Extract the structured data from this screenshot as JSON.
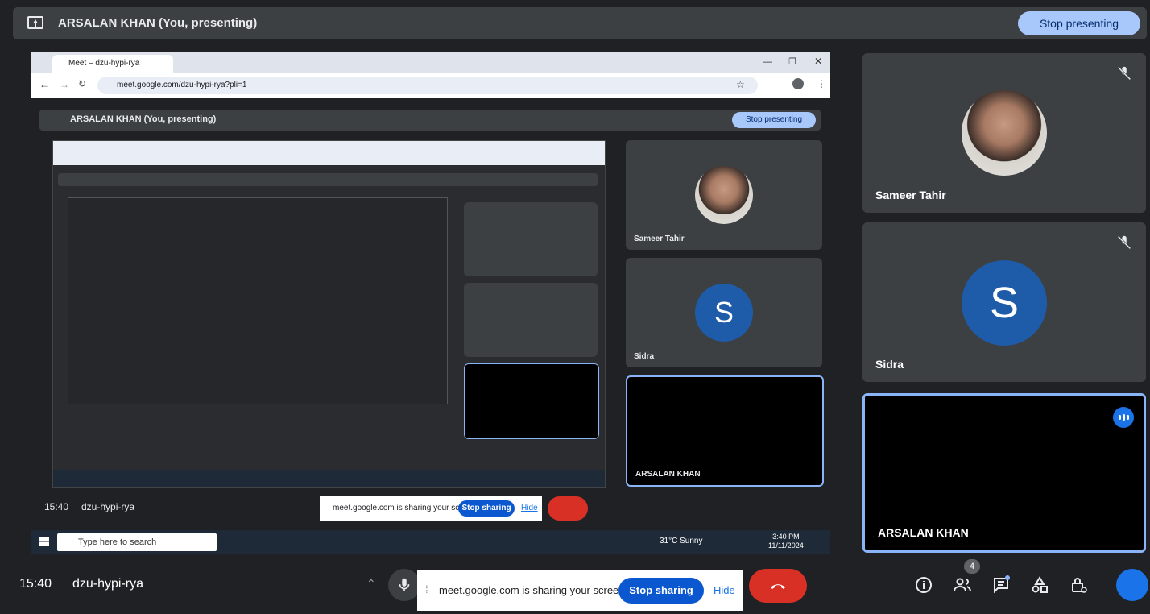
{
  "top_bar": {
    "title": "ARSALAN KHAN (You, presenting)",
    "stop_presenting": "Stop presenting"
  },
  "shared_screen": {
    "browser_tab": "Meet – dzu-hypi-rya",
    "url": "meet.google.com/dzu-hypi-rya?pli=1",
    "inner_title": "ARSALAN KHAN (You, presenting)",
    "inner_stop": "Stop presenting",
    "tiles": [
      {
        "name": "Sameer Tahir"
      },
      {
        "name": "Sidra",
        "initial": "S"
      },
      {
        "name": "ARSALAN KHAN"
      }
    ],
    "inner_clock": "15:40",
    "inner_code": "dzu-hypi-rya",
    "inner_share_text": "meet.google.com is sharing your screen.",
    "inner_share_stop": "Stop sharing",
    "inner_share_hide": "Hide",
    "taskbar": {
      "search": "Type here to search",
      "weather": "31°C  Sunny",
      "time": "3:40 PM",
      "date": "11/11/2024"
    }
  },
  "participants": [
    {
      "name": "Sameer Tahir",
      "muted": true
    },
    {
      "name": "Sidra",
      "initial": "S",
      "muted": true
    },
    {
      "name": "ARSALAN KHAN",
      "speaking": true
    }
  ],
  "bottom_bar": {
    "time": "15:40",
    "meeting_code": "dzu-hypi-rya",
    "share_text": "meet.google.com is sharing your screen.",
    "stop_sharing": "Stop sharing",
    "hide": "Hide",
    "people_count": "4"
  },
  "colors": {
    "background": "#202124",
    "tile": "#3c4043",
    "accent": "#a8c7fa",
    "end_call": "#d93025",
    "avatar": "#1e5ba8"
  }
}
